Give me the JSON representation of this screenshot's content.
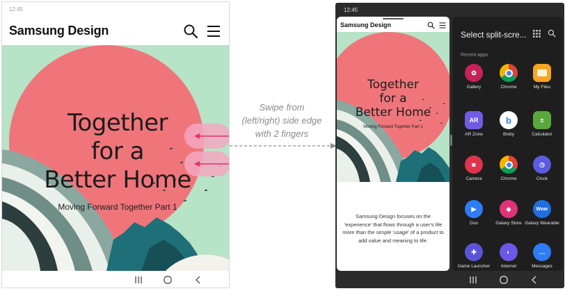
{
  "left_phone": {
    "status_time": "12:45",
    "app_title": "Samsung Design",
    "hero": {
      "headline_lines": [
        "Together",
        "for a",
        "Better Home"
      ],
      "subtitle": "Moving Forward Together Part 1"
    }
  },
  "instruction": {
    "lines": [
      "Swipe from",
      "(left/right) side edge",
      "with 2 fingers"
    ]
  },
  "right_phone": {
    "status_time": "12:45",
    "app_title": "Samsung Design",
    "hero": {
      "headline_lines": [
        "Together",
        "for a",
        "Better Home"
      ],
      "subtitle": "Moving Forward Together Part 1"
    },
    "description": "Samsung Design focuses on the 'experience' that flows through a user's life more than the simple 'usage' of a product to add value and meaning to life.",
    "tray": {
      "title": "Select split-scre...",
      "section_label": "Recent apps",
      "apps": [
        {
          "label": "Gallery",
          "icon": "flower-icon",
          "color": "#c8225b",
          "glyph": "✿"
        },
        {
          "label": "Chrome",
          "icon": "chrome-icon",
          "color": "#ffffff",
          "glyph": ""
        },
        {
          "label": "My Files",
          "icon": "folder-icon",
          "color": "#f5a623",
          "glyph": ""
        },
        {
          "label": "AR Zone",
          "icon": "ar-icon",
          "color": "#6f5be4",
          "glyph": "AR"
        },
        {
          "label": "Bixby",
          "icon": "bixby-icon",
          "color": "#ffffff",
          "glyph": "b"
        },
        {
          "label": "Calculator",
          "icon": "calculator-icon",
          "color": "#5aa83b",
          "glyph": "±"
        },
        {
          "label": "Camera",
          "icon": "camera-icon",
          "color": "#e0334d",
          "glyph": "◙"
        },
        {
          "label": "Chrome",
          "icon": "chrome-icon",
          "color": "#ffffff",
          "glyph": ""
        },
        {
          "label": "Clock",
          "icon": "clock-icon",
          "color": "#5b5ce0",
          "glyph": "◷"
        },
        {
          "label": "Duo",
          "icon": "duo-icon",
          "color": "#2f7df6",
          "glyph": "▶"
        },
        {
          "label": "Galaxy Store",
          "icon": "store-icon",
          "color": "#e0337a",
          "glyph": "◆"
        },
        {
          "label": "Galaxy Wearable",
          "icon": "wear-icon",
          "color": "#1f6fe0",
          "glyph": "Wear"
        },
        {
          "label": "Game Launcher",
          "icon": "game-icon",
          "color": "#5a55d8",
          "glyph": "✚"
        },
        {
          "label": "Internet",
          "icon": "internet-icon",
          "color": "#6a58e6",
          "glyph": "◐"
        },
        {
          "label": "Messages",
          "icon": "messages-icon",
          "color": "#2f7df6",
          "glyph": "…"
        }
      ]
    }
  },
  "colors": {
    "sun": "#f0757b",
    "sky": "#b7e3c6",
    "arrow": "#e0336e",
    "tray_bg": "#1e1e1e"
  }
}
